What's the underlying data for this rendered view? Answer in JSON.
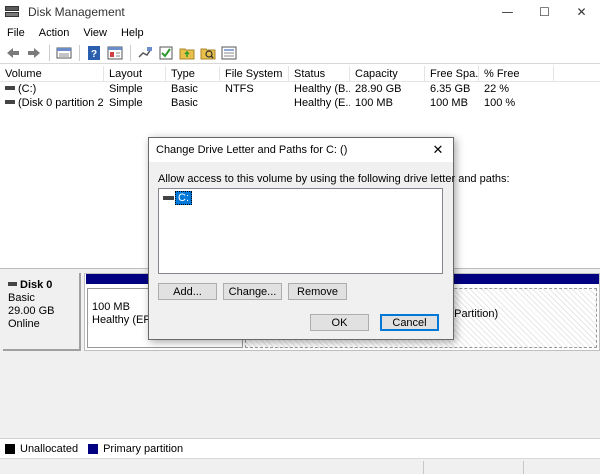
{
  "window": {
    "title": "Disk Management",
    "minimize_glyph": "—",
    "maximize_glyph": "☐",
    "close_glyph": "✕"
  },
  "menu": [
    "File",
    "Action",
    "View",
    "Help"
  ],
  "toolbar": {
    "icons": [
      "back-arrow-icon",
      "forward-arrow-icon",
      "volume-list-icon",
      "help-icon",
      "properties-icon",
      "connect-icon",
      "check-icon",
      "folder-icon",
      "search-folder-icon",
      "settings-icon"
    ]
  },
  "volume_table": {
    "columns": [
      "Volume",
      "Layout",
      "Type",
      "File System",
      "Status",
      "Capacity",
      "Free Spa...",
      "% Free"
    ],
    "rows": [
      [
        "(C:)",
        "Simple",
        "Basic",
        "NTFS",
        "Healthy (B...",
        "28.90 GB",
        "6.35 GB",
        "22 %"
      ],
      [
        "(Disk 0 partition 2)",
        "Simple",
        "Basic",
        "",
        "Healthy (E...",
        "100 MB",
        "100 MB",
        "100 %"
      ]
    ]
  },
  "disk": {
    "name": "Disk 0",
    "type": "Basic",
    "size": "29.00 GB",
    "state": "Online",
    "partition1": {
      "size": "100 MB",
      "status": "Healthy (EFI S"
    },
    "partition2_text": "a Partition)"
  },
  "legend": [
    {
      "label": "Unallocated",
      "color": "#000000"
    },
    {
      "label": "Primary partition",
      "color": "#000080"
    }
  ],
  "dialog": {
    "title": "Change Drive Letter and Paths for C: ()",
    "close_glyph": "✕",
    "description": "Allow access to this volume by using the following drive letter and paths:",
    "list_items": [
      "C:"
    ],
    "add_label": "Add...",
    "change_label": "Change...",
    "remove_label": "Remove",
    "ok_label": "OK",
    "cancel_label": "Cancel"
  }
}
